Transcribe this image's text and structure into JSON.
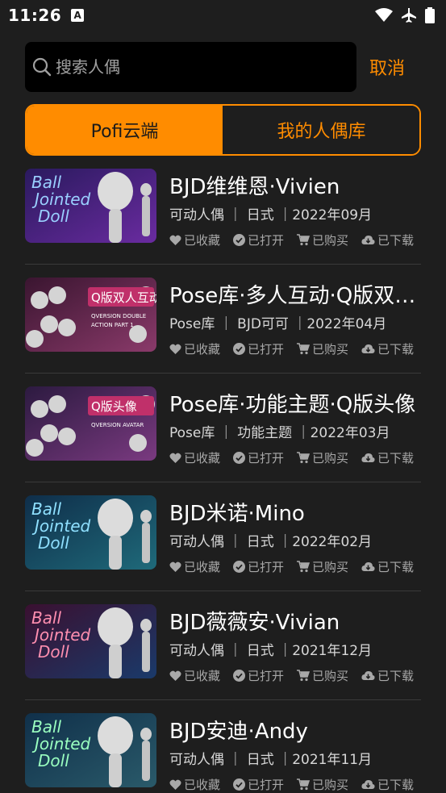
{
  "status_bar": {
    "time": "11:26",
    "a_badge": "A"
  },
  "search": {
    "placeholder": "搜索人偶",
    "cancel_label": "取消"
  },
  "tabs": [
    {
      "label": "Pofi云端",
      "active": true
    },
    {
      "label": "我的人偶库",
      "active": false
    }
  ],
  "colors": {
    "accent": "#ff8c00",
    "background": "#1e1e1e"
  },
  "status_labels": {
    "favorited": "已收藏",
    "opened": "已打开",
    "purchased": "已购买",
    "downloaded": "已下载"
  },
  "items": [
    {
      "title": "BJD维维恩·Vivien",
      "meta": "可动人偶 ｜ 日式 ｜2022年09月",
      "thumb": {
        "kind": "doll",
        "line1": "Ball",
        "line2": "Jointed",
        "line3": "Doll",
        "bg1": "#2a1a5e",
        "bg2": "#6a2ba0",
        "text": "#9ad0ff"
      }
    },
    {
      "title": "Pose库·多人互动·Q版双人互动",
      "meta": "Pose库 ｜ BJD可可 ｜2022年04月",
      "thumb": {
        "kind": "pose",
        "line1": "Q版双人互动",
        "line2": "QVERSION DOUBLE",
        "line3": "ACTION PART 1",
        "bg1": "#3a1530",
        "bg2": "#8a3a6a",
        "text": "#ffffff"
      }
    },
    {
      "title": "Pose库·功能主题·Q版头像",
      "meta": "Pose库 ｜ 功能主题 ｜2022年03月",
      "thumb": {
        "kind": "pose",
        "line1": "Q版头像",
        "line2": "QVERSION AVATAR",
        "line3": "",
        "bg1": "#2c1a40",
        "bg2": "#7a3a80",
        "text": "#ffffff"
      }
    },
    {
      "title": "BJD米诺·Mino",
      "meta": "可动人偶 ｜ 日式 ｜2022年02月",
      "thumb": {
        "kind": "doll",
        "line1": "Ball",
        "line2": "Jointed",
        "line3": "Doll",
        "bg1": "#0f2e4a",
        "bg2": "#1f6a7a",
        "text": "#8fe0ff"
      }
    },
    {
      "title": "BJD薇薇安·Vivian",
      "meta": "可动人偶 ｜ 日式 ｜2021年12月",
      "thumb": {
        "kind": "doll",
        "line1": "Ball",
        "line2": "Jointed",
        "line3": "Doll",
        "bg1": "#3a1030",
        "bg2": "#1a3a6a",
        "text": "#ff8fb0"
      }
    },
    {
      "title": "BJD安迪·Andy",
      "meta": "可动人偶 ｜ 日式 ｜2021年11月",
      "thumb": {
        "kind": "doll",
        "line1": "Ball",
        "line2": "Jointed",
        "line3": "Doll",
        "bg1": "#10304a",
        "bg2": "#2a5a6a",
        "text": "#9affc0"
      }
    }
  ]
}
